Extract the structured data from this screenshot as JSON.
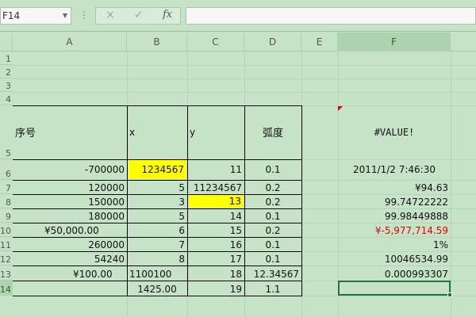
{
  "formula_bar": {
    "name_box": "F14",
    "separator": "⋮",
    "cancel_icon": "×",
    "enter_icon": "✓",
    "fx_label": "fx",
    "formula_value": ""
  },
  "columns": [
    "A",
    "B",
    "C",
    "D",
    "E",
    "F"
  ],
  "rows": [
    "1",
    "2",
    "3",
    "4",
    "5",
    "6",
    "7",
    "8",
    "9",
    "10",
    "11",
    "12",
    "13",
    "14"
  ],
  "headers": {
    "a": "序号",
    "b": "x",
    "c": "y",
    "d": "弧度",
    "f": "#VALUE!"
  },
  "data_rows": [
    {
      "a": "-700000",
      "b": "1234567",
      "c": "11",
      "d": "0.1",
      "f": "2011/1/2 7:46:30"
    },
    {
      "a": "120000",
      "b": "5",
      "c": "11234567",
      "d": "0.2",
      "f": "¥94.63"
    },
    {
      "a": "150000",
      "b": "3",
      "c": "13",
      "d": "0.2",
      "f": "99.74722222"
    },
    {
      "a": "180000",
      "b": "5",
      "c": "14",
      "d": "0.1",
      "f": "99.98449888"
    },
    {
      "a": "¥50,000.00",
      "b": "6",
      "c": "15",
      "d": "0.2",
      "f": "¥-5,977,714.59"
    },
    {
      "a": "260000",
      "b": "7",
      "c": "16",
      "d": "0.1",
      "f": "1%"
    },
    {
      "a": "54240",
      "b": "8",
      "c": "17",
      "d": "0.1",
      "f": "10046534.99"
    },
    {
      "a": "¥100.00",
      "b": "1100100",
      "c": "18",
      "d": "12.34567",
      "f": "0.000993307"
    },
    {
      "a": "",
      "b": "1425.00",
      "c": "19",
      "d": "1.1",
      "f": ""
    }
  ],
  "colors": {
    "sheet_bg": "#c6e3c8",
    "highlight": "#ffff00",
    "negative": "#e60000",
    "selection": "#217346"
  }
}
